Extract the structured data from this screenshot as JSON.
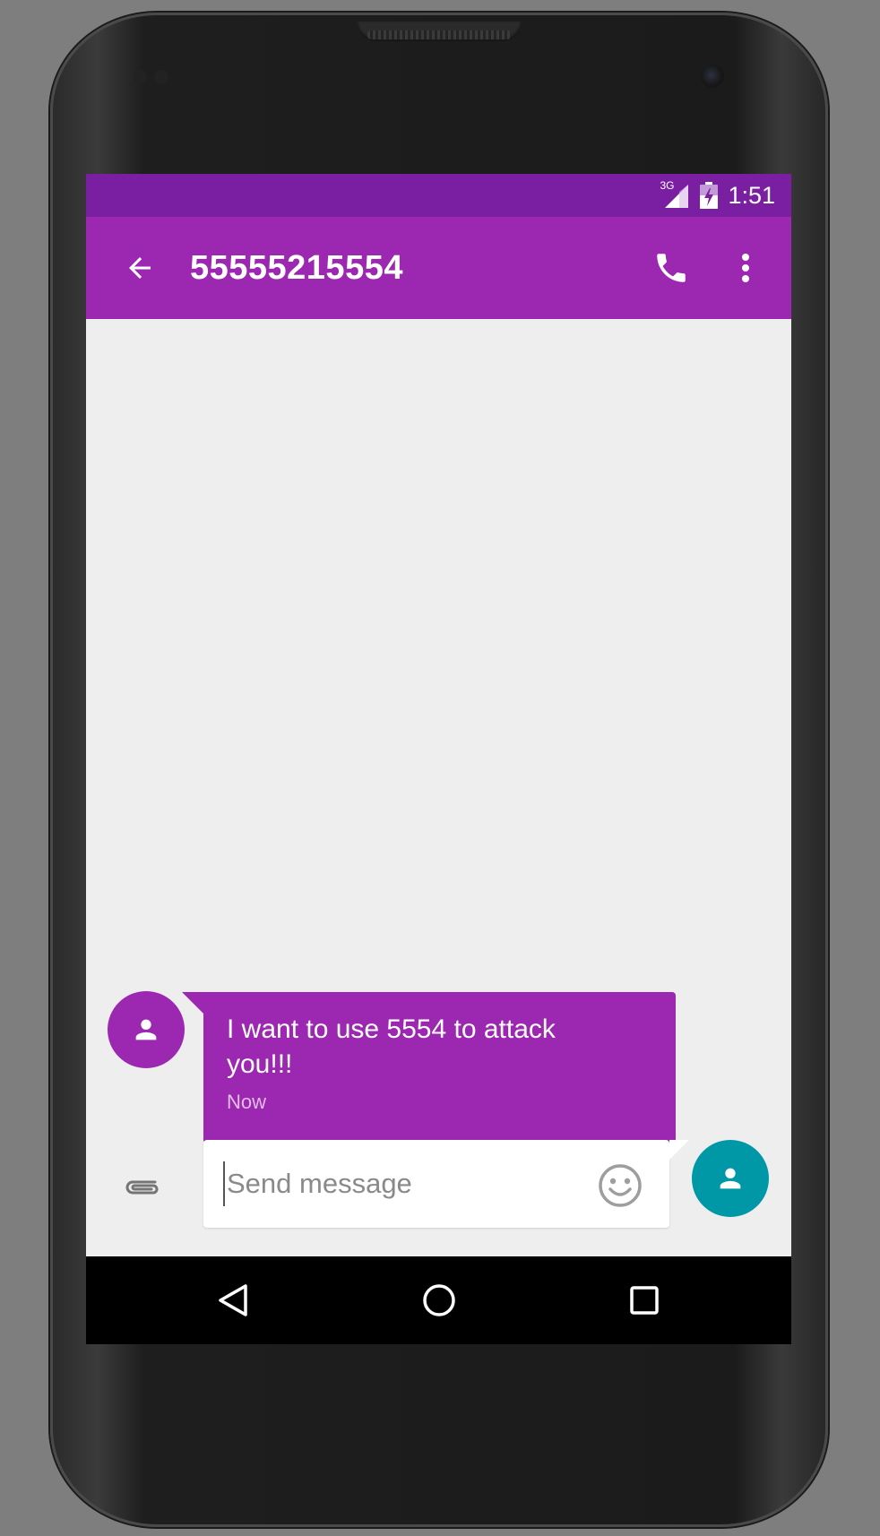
{
  "status_bar": {
    "network_label": "3G",
    "time": "1:51",
    "signal_icon": "signal-icon",
    "battery_icon": "battery-charging-icon"
  },
  "app_bar": {
    "title": "55555215554",
    "back_icon": "arrow-back-icon",
    "call_icon": "phone-icon",
    "more_icon": "more-vert-icon"
  },
  "messages": [
    {
      "direction": "incoming",
      "text": "I want to use 5554 to attack you!!!",
      "time": "Now",
      "avatar_icon": "person-icon"
    }
  ],
  "compose": {
    "placeholder": "Send message",
    "attach_icon": "paperclip-icon",
    "emoji_icon": "smiley-icon",
    "send_avatar_icon": "person-icon"
  },
  "nav_bar": {
    "back_icon": "triangle-back-icon",
    "home_icon": "circle-home-icon",
    "recents_icon": "square-recents-icon"
  },
  "colors": {
    "status_bar": "#7b1fa2",
    "app_bar": "#9c27b0",
    "message_bubble": "#9c27b0",
    "send_avatar": "#0097a7",
    "background": "#eeeeee"
  }
}
